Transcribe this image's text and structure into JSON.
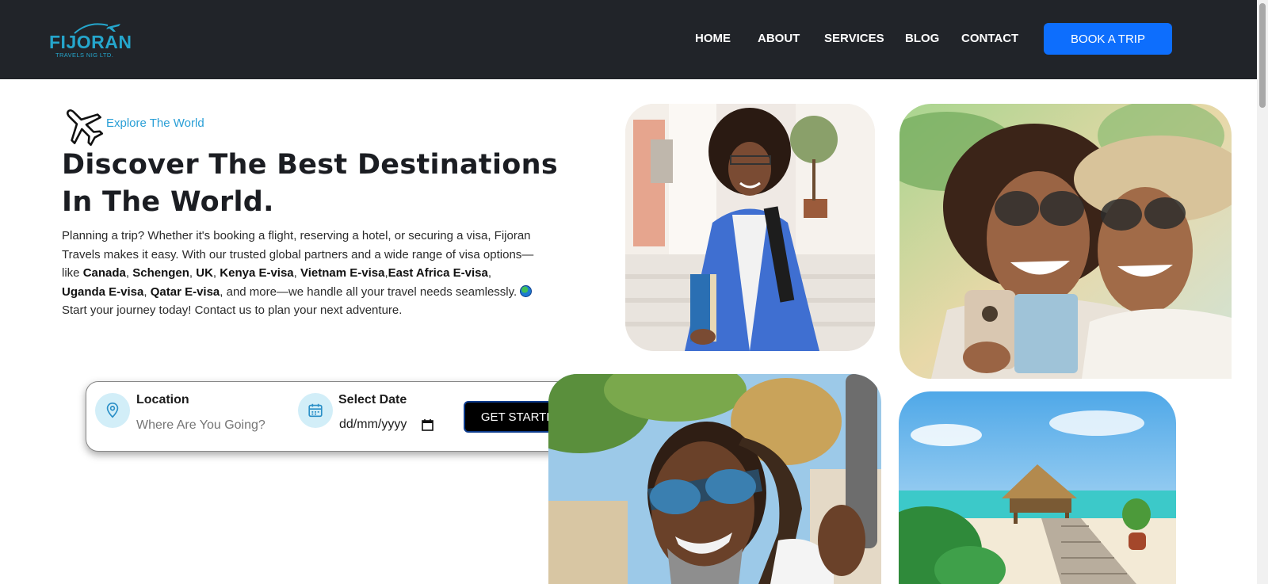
{
  "brand": {
    "name": "FIJORAN",
    "subtitle": "TRAVELS NIG LTD.",
    "color": "#25a6cc"
  },
  "nav": {
    "items": [
      "HOME",
      "ABOUT",
      "SERVICES",
      "BLOG",
      "CONTACT"
    ],
    "cta": "BOOK A TRIP",
    "cta_color": "#0d6efd",
    "background": "#212429"
  },
  "hero": {
    "eyebrow": "Explore The World",
    "title": "Discover The Best Destinations In The World.",
    "description": {
      "intro": "Planning a trip? Whether it's booking a flight, reserving a hotel, or securing a visa, Fijoran Travels makes it easy. With our trusted global partners and a wide range of visa options—like ",
      "visas": [
        "Canada",
        "Schengen",
        "UK",
        "Kenya E-visa",
        "Vietnam E-visa",
        "East Africa E-visa",
        "Uganda E-visa",
        "Qatar E-visa"
      ],
      "outro": ", and more—we handle all your travel needs seamlessly. ",
      "cta_line": " Start your journey today! Contact us to plan your next adventure."
    }
  },
  "search": {
    "location_label": "Location",
    "location_placeholder": "Where Are You Going?",
    "date_label": "Select Date",
    "date_placeholder": "dd/mm/yyyy",
    "button": "GET STARTED"
  },
  "icons": {
    "plane": "airplane-icon",
    "location": "map-pin-icon",
    "calendar": "calendar-icon",
    "globe": "globe-emoji-icon"
  }
}
